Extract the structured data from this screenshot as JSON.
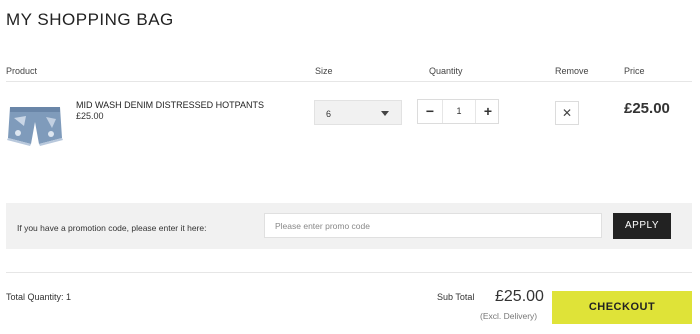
{
  "page": {
    "title": "MY SHOPPING BAG"
  },
  "table_headers": {
    "product": "Product",
    "size": "Size",
    "quantity": "Quantity",
    "remove": "Remove",
    "price": "Price"
  },
  "items": [
    {
      "name": "MID WASH DENIM DISTRESSED HOTPANTS",
      "unit_price": "£25.00",
      "size": "6",
      "quantity": "1",
      "line_price": "£25.00",
      "thumbnail": "denim-hotpants-image"
    }
  ],
  "controls": {
    "minus": "−",
    "plus": "+",
    "remove": "✕"
  },
  "promo": {
    "label": "If you have a promotion code, please enter it here:",
    "placeholder": "Please enter promo code",
    "value": "",
    "apply_label": "APPLY"
  },
  "summary": {
    "total_quantity": "Total Quantity: 1",
    "subtotal_label": "Sub Total",
    "subtotal_value": "£25.00",
    "delivery_note": "(Excl. Delivery)",
    "checkout_label": "CHECKOUT"
  },
  "colors": {
    "checkout_bg": "#dfe338",
    "apply_bg": "#222222",
    "promo_bar_bg": "#f1f1f1"
  }
}
